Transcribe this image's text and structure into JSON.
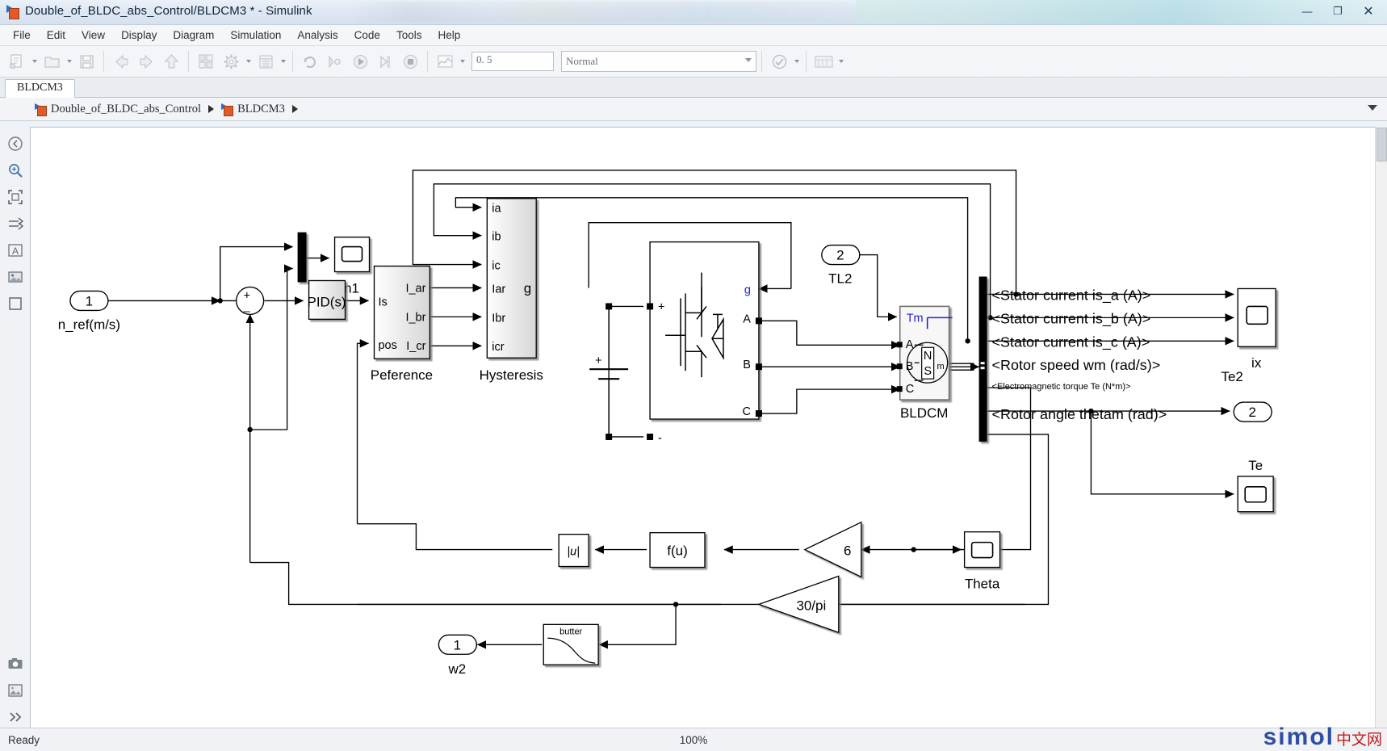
{
  "window": {
    "title": "Double_of_BLDC_abs_Control/BLDCM3 * - Simulink",
    "app_icon": "simulink-model-icon",
    "buttons": {
      "minimize": "—",
      "maximize": "❐",
      "close": "✕"
    }
  },
  "menubar": {
    "items": [
      "File",
      "Edit",
      "View",
      "Display",
      "Diagram",
      "Simulation",
      "Analysis",
      "Code",
      "Tools",
      "Help"
    ]
  },
  "toolbar": {
    "new_label": "new-model",
    "open_label": "open-model",
    "save_label": "save-model",
    "back_label": "navigate-back",
    "forward_label": "navigate-forward",
    "up_label": "navigate-up",
    "library_label": "library-browser",
    "config_label": "model-configuration-parameters",
    "explorer_label": "model-explorer",
    "update_label": "update-diagram",
    "fast_restart_label": "fast-restart",
    "run_label": "run-simulation",
    "step_label": "step-forward",
    "stop_label": "stop-simulation",
    "scope_label": "simulation-data-inspector",
    "sim_time": "0. 5",
    "sim_mode": "Normal",
    "check_label": "model-advisor",
    "perspective_label": "perspective-views"
  },
  "tabs": [
    {
      "label": "BLDCM3",
      "active": true
    }
  ],
  "breadcrumb": {
    "back_label": "back",
    "items": [
      {
        "label": "Double_of_BLDC_abs_Control",
        "icon": "simulink-model-icon"
      },
      {
        "label": "BLDCM3",
        "icon": "simulink-subsystem-icon"
      }
    ],
    "expand_label": "expand-breadcrumb"
  },
  "palette": {
    "items": [
      {
        "name": "navigate-up-to-parent",
        "icon": "circle-arrow-left-icon"
      },
      {
        "name": "zoom-tool",
        "icon": "magnifier-icon"
      },
      {
        "name": "fit-to-view",
        "icon": "fit-screen-icon"
      },
      {
        "name": "signal-routing",
        "icon": "arrow-right-icon"
      },
      {
        "name": "annotation-text",
        "icon": "text-A-icon"
      },
      {
        "name": "insert-image",
        "icon": "picture-icon"
      },
      {
        "name": "insert-area",
        "icon": "square-icon"
      },
      {
        "name": "camera-snapshot",
        "icon": "camera-icon"
      },
      {
        "name": "insert-figure",
        "icon": "image-frame-icon"
      },
      {
        "name": "expand-palette",
        "icon": "double-chevron-right-icon"
      }
    ]
  },
  "statusbar": {
    "status": "Ready",
    "zoom": "100%",
    "watermark_main": "simol",
    "watermark_sub": "中文网"
  },
  "diagram": {
    "blocks": {
      "inport_nref": {
        "port_number": "1",
        "label": "n_ref(m/s)"
      },
      "sum": {
        "plus": "+",
        "minus": "_"
      },
      "mux": {
        "label": ""
      },
      "scope_n1": {
        "label": "n1"
      },
      "pid": {
        "label": "PID(s)"
      },
      "peference": {
        "label": "Peference",
        "inputs": [
          "Is",
          "pos"
        ],
        "outputs": [
          "I_ar",
          "I_br",
          "I_cr"
        ]
      },
      "hysteresis": {
        "label": "Hysteresis",
        "inputs": [
          "ia",
          "ib",
          "ic",
          "Iar",
          "Ibr",
          "icr"
        ],
        "outputs": [
          "g"
        ]
      },
      "dc_source": {
        "plus": "+"
      },
      "bridge": {
        "inputs": [
          "+",
          "-",
          "g"
        ],
        "outputs": [
          "A",
          "B",
          "C"
        ]
      },
      "inport_tl2": {
        "port_number": "2",
        "label": "TL2"
      },
      "bldcm": {
        "label": "BLDCM",
        "inputs": [
          "Tm",
          "A",
          "B",
          "C"
        ],
        "outputs": [
          "m"
        ],
        "rotor_north": "N",
        "rotor_south": "S"
      },
      "bus_selector": {
        "signals": [
          "<Stator current is_a (A)>",
          "<Stator current is_b (A)>",
          "<Stator current is_c (A)>",
          "<Rotor speed wm (rad/s)>",
          "<Electromagnetic torque Te (N*m)>",
          "<Rotor angle thetam (rad)>"
        ]
      },
      "scope_ix": {
        "label": "ix"
      },
      "outport_te2": {
        "port_number": "2",
        "label": "Te2"
      },
      "scope_te": {
        "label": "Te"
      },
      "scope_theta": {
        "label": "Theta"
      },
      "gain_6": {
        "label": "6"
      },
      "gain_30pi": {
        "label": "30/pi"
      },
      "fcn": {
        "label": "f(u)"
      },
      "abs": {
        "label": "|u|"
      },
      "butter": {
        "label": "butter"
      },
      "outport_w2": {
        "port_number": "1",
        "label": "w2"
      }
    }
  }
}
